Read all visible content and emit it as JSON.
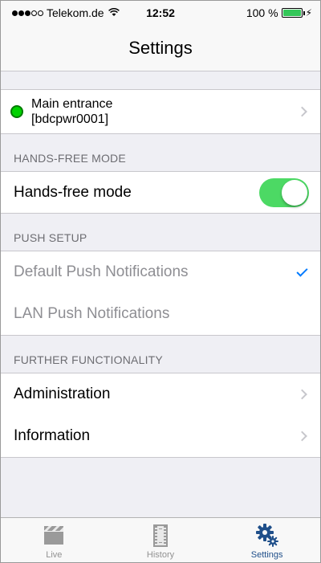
{
  "status_bar": {
    "carrier": "Telekom.de",
    "time": "12:52",
    "battery": "100 %",
    "signal_bars_filled": 3,
    "battery_level": 1.0
  },
  "nav": {
    "title": "Settings"
  },
  "device": {
    "name": "Main entrance",
    "id": "[bdcpwr0001]",
    "status_color": "#00d200"
  },
  "sections": {
    "hands_free": {
      "header": "HANDS-FREE MODE",
      "toggle_label": "Hands-free mode",
      "toggle_on": true
    },
    "push_setup": {
      "header": "PUSH SETUP",
      "default_label": "Default Push Notifications",
      "lan_label": "LAN Push Notifications"
    },
    "further": {
      "header": "FURTHER FUNCTIONALITY",
      "administration": "Administration",
      "information": "Information"
    }
  },
  "tabs": [
    {
      "label": "Live",
      "icon": "clapperboard-icon"
    },
    {
      "label": "History",
      "icon": "film-icon"
    },
    {
      "label": "Settings",
      "icon": "gears-icon"
    }
  ],
  "colors": {
    "accent": "#007aff",
    "toggle_on": "#4cd964",
    "active_tab": "#1f4f8a"
  }
}
